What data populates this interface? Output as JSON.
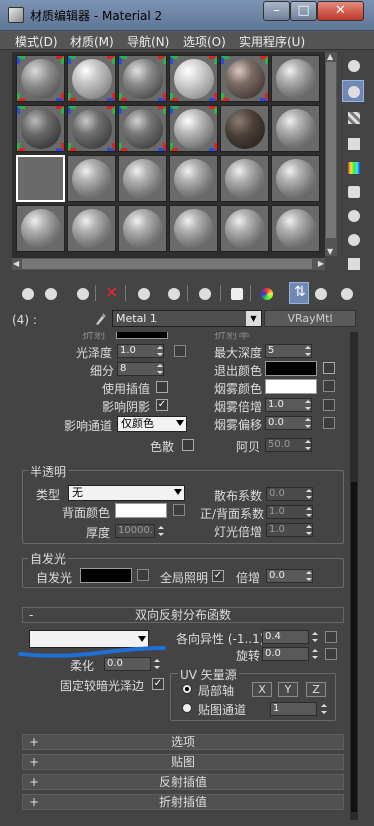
{
  "window": {
    "title": "材质编辑器 - Material 2",
    "minimize": "–",
    "maximize": "□",
    "close": "✕"
  },
  "menu": [
    "模式(D)",
    "材质(M)",
    "导航(N)",
    "选项(O)",
    "实用程序(U)"
  ],
  "slot_name_label": "(4) :",
  "material_name": "Metal 1",
  "material_type": "VRayMtl",
  "top_partial": {
    "left_cut": "折射",
    "right_cut": "折射率"
  },
  "props": {
    "glossiness": {
      "label": "光泽度",
      "value": "1.0"
    },
    "subdivs": {
      "label": "细分",
      "value": "8"
    },
    "use_interp": {
      "label": "使用插值"
    },
    "affect_shadows": {
      "label": "影响阴影",
      "checked": "✓"
    },
    "affect_channels": {
      "label": "影响通道",
      "value": "仅颜色"
    },
    "dispersion": {
      "label": "色散"
    },
    "max_depth": {
      "label": "最大深度",
      "value": "5"
    },
    "exit_color": {
      "label": "退出颜色"
    },
    "fog_color": {
      "label": "烟雾颜色"
    },
    "fog_multiplier": {
      "label": "烟雾倍增",
      "value": "1.0"
    },
    "fog_bias": {
      "label": "烟雾偏移",
      "value": "0.0"
    },
    "abbe": {
      "label": "阿贝",
      "value": "50.0"
    }
  },
  "translucency": {
    "title": "半透明",
    "type_label": "类型",
    "type_value": "无",
    "back_color_label": "背面颜色",
    "thickness_label": "厚度",
    "thickness_value": "10000.",
    "scatter_label": "散布系数",
    "scatter_value": "0.0",
    "fwd_back_label": "正/背面系数",
    "fwd_back_value": "1.0",
    "light_mult_label": "灯光倍增",
    "light_mult_value": "1.0"
  },
  "self_illum": {
    "title": "自发光",
    "label": "自发光",
    "gi_label": "全局照明",
    "gi_checked": "✓",
    "mult_label": "倍增",
    "mult_value": "0.0"
  },
  "brdf": {
    "sign": "-",
    "title": "双向反射分布函数",
    "type_value": "",
    "anisotropy_label": "各向异性 (-1..1)",
    "anisotropy_value": "0.4",
    "rotation_label": "旋转",
    "rotation_value": "0.0",
    "soften_label": "柔化",
    "soften_value": "0.0",
    "fix_dark_label": "固定较暗光泽边",
    "fix_dark_checked": "✓",
    "uv_title": "UV 矢量源",
    "local_axis_label": "局部轴",
    "map_channel_label": "贴图通道",
    "map_channel_value": "1",
    "x": "X",
    "y": "Y",
    "z": "Z"
  },
  "rollouts": [
    {
      "sign": "+",
      "title": "选项"
    },
    {
      "sign": "+",
      "title": "贴图"
    },
    {
      "sign": "+",
      "title": "反射插值"
    },
    {
      "sign": "+",
      "title": "折射插值"
    }
  ],
  "colors": {
    "accent_blue": "#1f6fd6",
    "toggle_on": "#6f88b5"
  }
}
